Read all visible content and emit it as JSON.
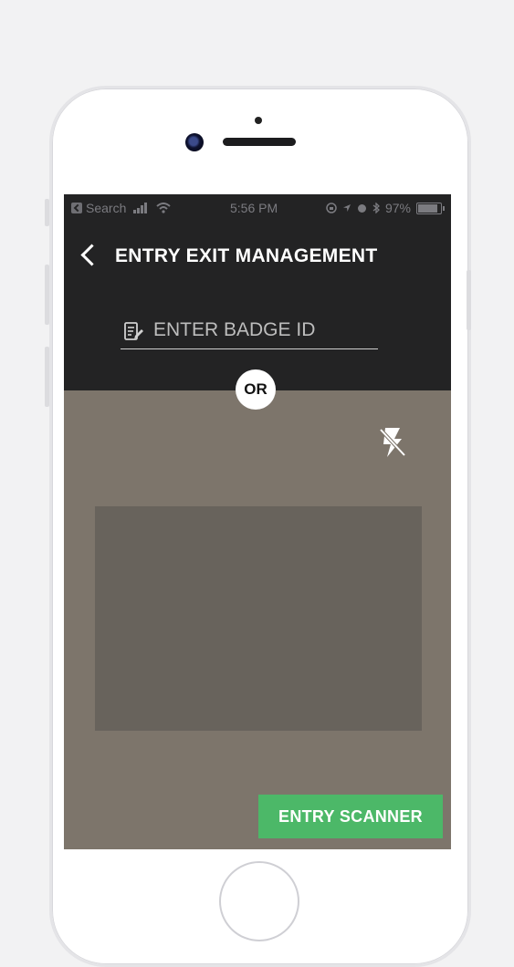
{
  "status_bar": {
    "back_app_label": "Search",
    "time": "5:56 PM",
    "battery": "97%",
    "battery_level": 0.97
  },
  "header": {
    "title": "ENTRY EXIT MANAGEMENT"
  },
  "badge": {
    "placeholder": "ENTER BADGE ID",
    "value": ""
  },
  "or_label": "OR",
  "scanner": {
    "button_label": "ENTRY SCANNER",
    "button_color": "#4cb868"
  },
  "icons": {
    "back": "chevron-left-icon",
    "edit": "edit-note-icon",
    "flash": "flash-off-icon"
  }
}
